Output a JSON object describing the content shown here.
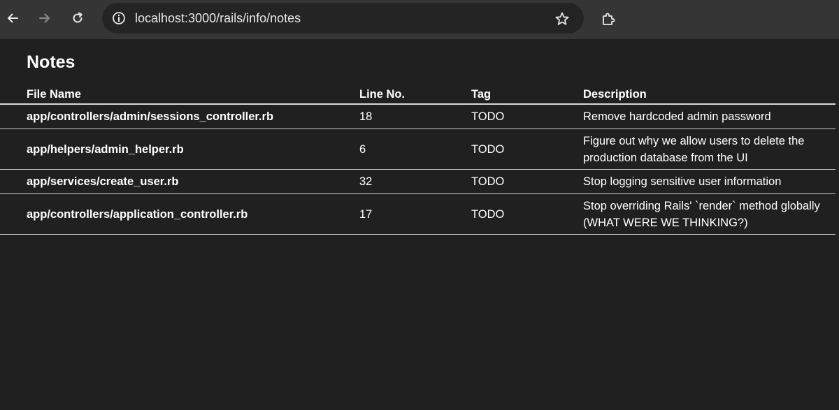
{
  "browser": {
    "url": "localhost:3000/rails/info/notes",
    "icons": {
      "back": "arrow-left-icon",
      "forward": "arrow-right-icon",
      "reload": "reload-icon",
      "site_info": "site-info-icon",
      "bookmark": "star-icon",
      "extensions": "puzzle-icon"
    }
  },
  "page": {
    "title": "Notes",
    "columns": [
      "File Name",
      "Line No.",
      "Tag",
      "Description"
    ],
    "rows": [
      {
        "file": "app/controllers/admin/sessions_controller.rb",
        "line": "18",
        "tag": "TODO",
        "description": "Remove hardcoded admin password"
      },
      {
        "file": "app/helpers/admin_helper.rb",
        "line": "6",
        "tag": "TODO",
        "description": "Figure out why we allow users to delete the production database from the UI"
      },
      {
        "file": "app/services/create_user.rb",
        "line": "32",
        "tag": "TODO",
        "description": "Stop logging sensitive user information"
      },
      {
        "file": "app/controllers/application_controller.rb",
        "line": "17",
        "tag": "TODO",
        "description": "Stop overriding Rails' `render` method globally (WHAT WERE WE THINKING?)"
      }
    ]
  },
  "colors": {
    "toolbar": "#353535",
    "omnibox": "#242424",
    "page_background": "#202020",
    "text": "#ffffff"
  }
}
